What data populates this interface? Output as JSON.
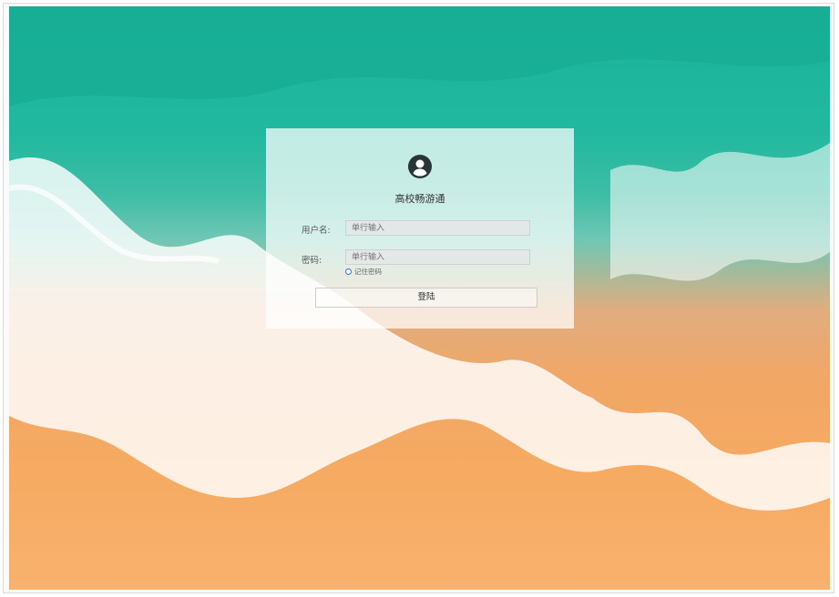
{
  "app": {
    "title": "高校畅游通"
  },
  "form": {
    "username_label": "用户名:",
    "username_placeholder": "单行输入",
    "password_label": "密码:",
    "password_placeholder": "单行输入",
    "remember_label": "记住密码",
    "login_label": "登陆"
  },
  "icons": {
    "avatar": "user-circle-icon",
    "remember": "radio-icon"
  },
  "colors": {
    "ocean": "#19b59a",
    "sand": "#f6aa62",
    "accent": "#3a6de0"
  }
}
